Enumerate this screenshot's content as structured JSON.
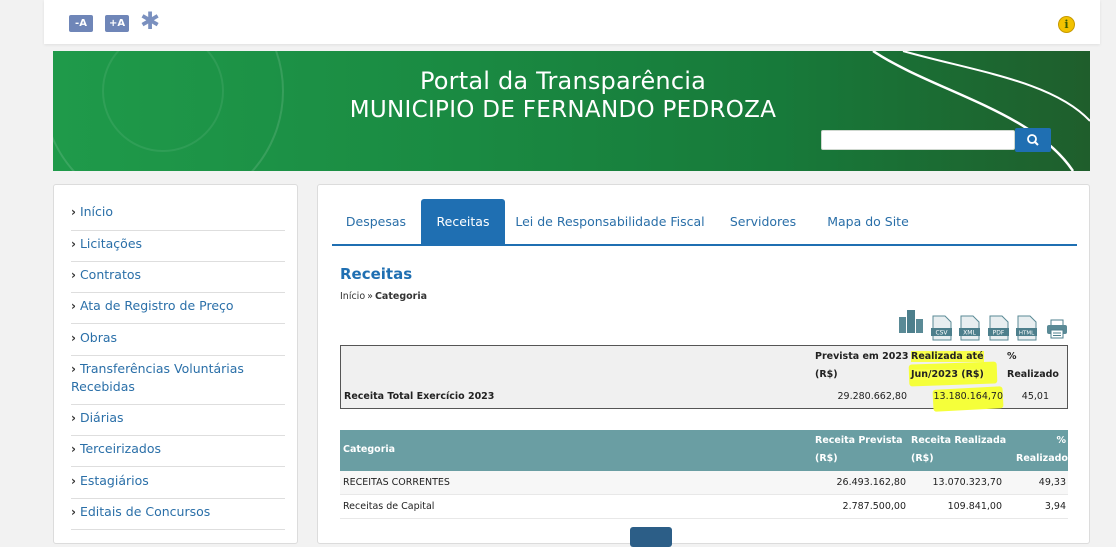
{
  "toolbar": {
    "font_decrease": "-A",
    "font_increase": "+A",
    "contrast": "✱"
  },
  "banner": {
    "title_line1": "Portal da Transparência",
    "title_line2": "MUNICIPIO DE FERNANDO PEDROZA",
    "search_placeholder": ""
  },
  "sidebar": {
    "items": [
      {
        "label": "Início"
      },
      {
        "label": "Licitações"
      },
      {
        "label": "Contratos"
      },
      {
        "label": "Ata de Registro de Preço"
      },
      {
        "label": "Obras"
      },
      {
        "label": "Transferências Voluntárias Recebidas"
      },
      {
        "label": "Diárias"
      },
      {
        "label": "Terceirizados"
      },
      {
        "label": "Estagiários"
      },
      {
        "label": "Editais de Concursos"
      }
    ]
  },
  "tabs": [
    {
      "label": "Despesas"
    },
    {
      "label": "Receitas"
    },
    {
      "label": "Lei de Responsabilidade Fiscal"
    },
    {
      "label": "Servidores"
    },
    {
      "label": "Mapa do Site"
    }
  ],
  "page": {
    "title": "Receitas",
    "breadcrumb_home": "Início",
    "breadcrumb_sep": "»",
    "breadcrumb_current": "Categoria"
  },
  "exports": {
    "csv": "CSV",
    "xml": "XML",
    "pdf": "PDF",
    "html": "HTML"
  },
  "summary": {
    "col_prevista_line1": "Prevista em 2023",
    "col_prevista_line2": "(R$)",
    "col_realizada_line1": "Realizada até",
    "col_realizada_line2": "Jun/2023 (R$)",
    "col_pct_line1": "%",
    "col_pct_line2": "Realizado",
    "row_label": "Receita Total Exercício 2023",
    "prevista": "29.280.662,80",
    "realizada": "13.180.164,70",
    "pct": "45,01"
  },
  "categories": {
    "head_categoria": "Categoria",
    "head_prevista_line1": "Receita Prevista",
    "head_prevista_line2": "(R$)",
    "head_realizada_line1": "Receita Realizada",
    "head_realizada_line2": "(R$)",
    "head_pct_line1": "%",
    "head_pct_line2": "Realizado",
    "rows": [
      {
        "categoria": "RECEITAS CORRENTES",
        "prevista": "26.493.162,80",
        "realizada": "13.070.323,70",
        "pct": "49,33"
      },
      {
        "categoria": "Receitas de Capital",
        "prevista": "2.787.500,00",
        "realizada": "109.841,00",
        "pct": "3,94"
      }
    ]
  },
  "colors": {
    "accent": "#1f6fb2",
    "banner_green": "#1a8a42",
    "table_head": "#6a9ea3",
    "highlight": "#f8ff4a"
  }
}
